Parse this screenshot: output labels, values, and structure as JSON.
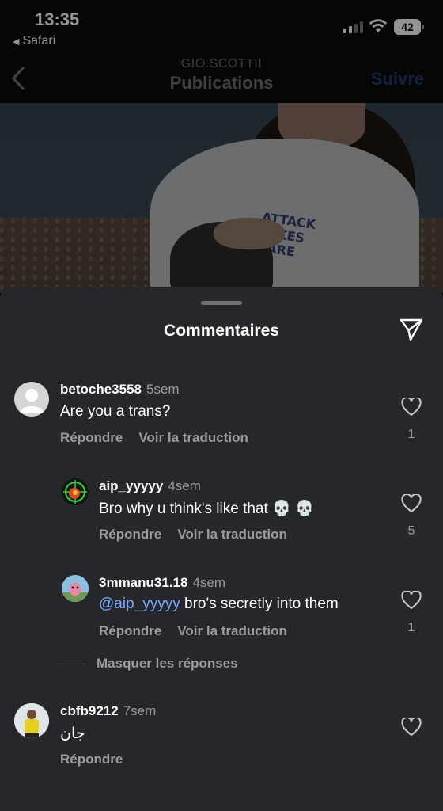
{
  "status_bar": {
    "time": "13:35",
    "back_app": "Safari",
    "battery": "42"
  },
  "header": {
    "username": "GIO.SCOTTII",
    "title": "Publications",
    "follow_label": "Suivre"
  },
  "photo": {
    "print_text": "ATTACK TAKES CARE"
  },
  "sheet": {
    "title": "Commentaires"
  },
  "comments": [
    {
      "user": "betoche3558",
      "ago": "5sem",
      "text": "Are you a trans?",
      "reply": "Répondre",
      "translate": "Voir la traduction",
      "likes": "1"
    },
    {
      "user": "aip_yyyyy",
      "ago": "4sem",
      "text": "Bro why u think's like that 💀 💀",
      "reply": "Répondre",
      "translate": "Voir la traduction",
      "likes": "5"
    },
    {
      "user": "3mmanu31.18",
      "ago": "4sem",
      "mention": "@aip_yyyyy",
      "text": " bro's secretly into them",
      "reply": "Répondre",
      "translate": "Voir la traduction",
      "likes": "1"
    },
    {
      "user": "cbfb9212",
      "ago": "7sem",
      "text": "جان",
      "reply": "Répondre"
    }
  ],
  "hide_replies_label": "Masquer les réponses",
  "colors": {
    "sheet_bg": "#25272b",
    "mention": "#7aa8ff",
    "follow": "#1c3d68"
  }
}
